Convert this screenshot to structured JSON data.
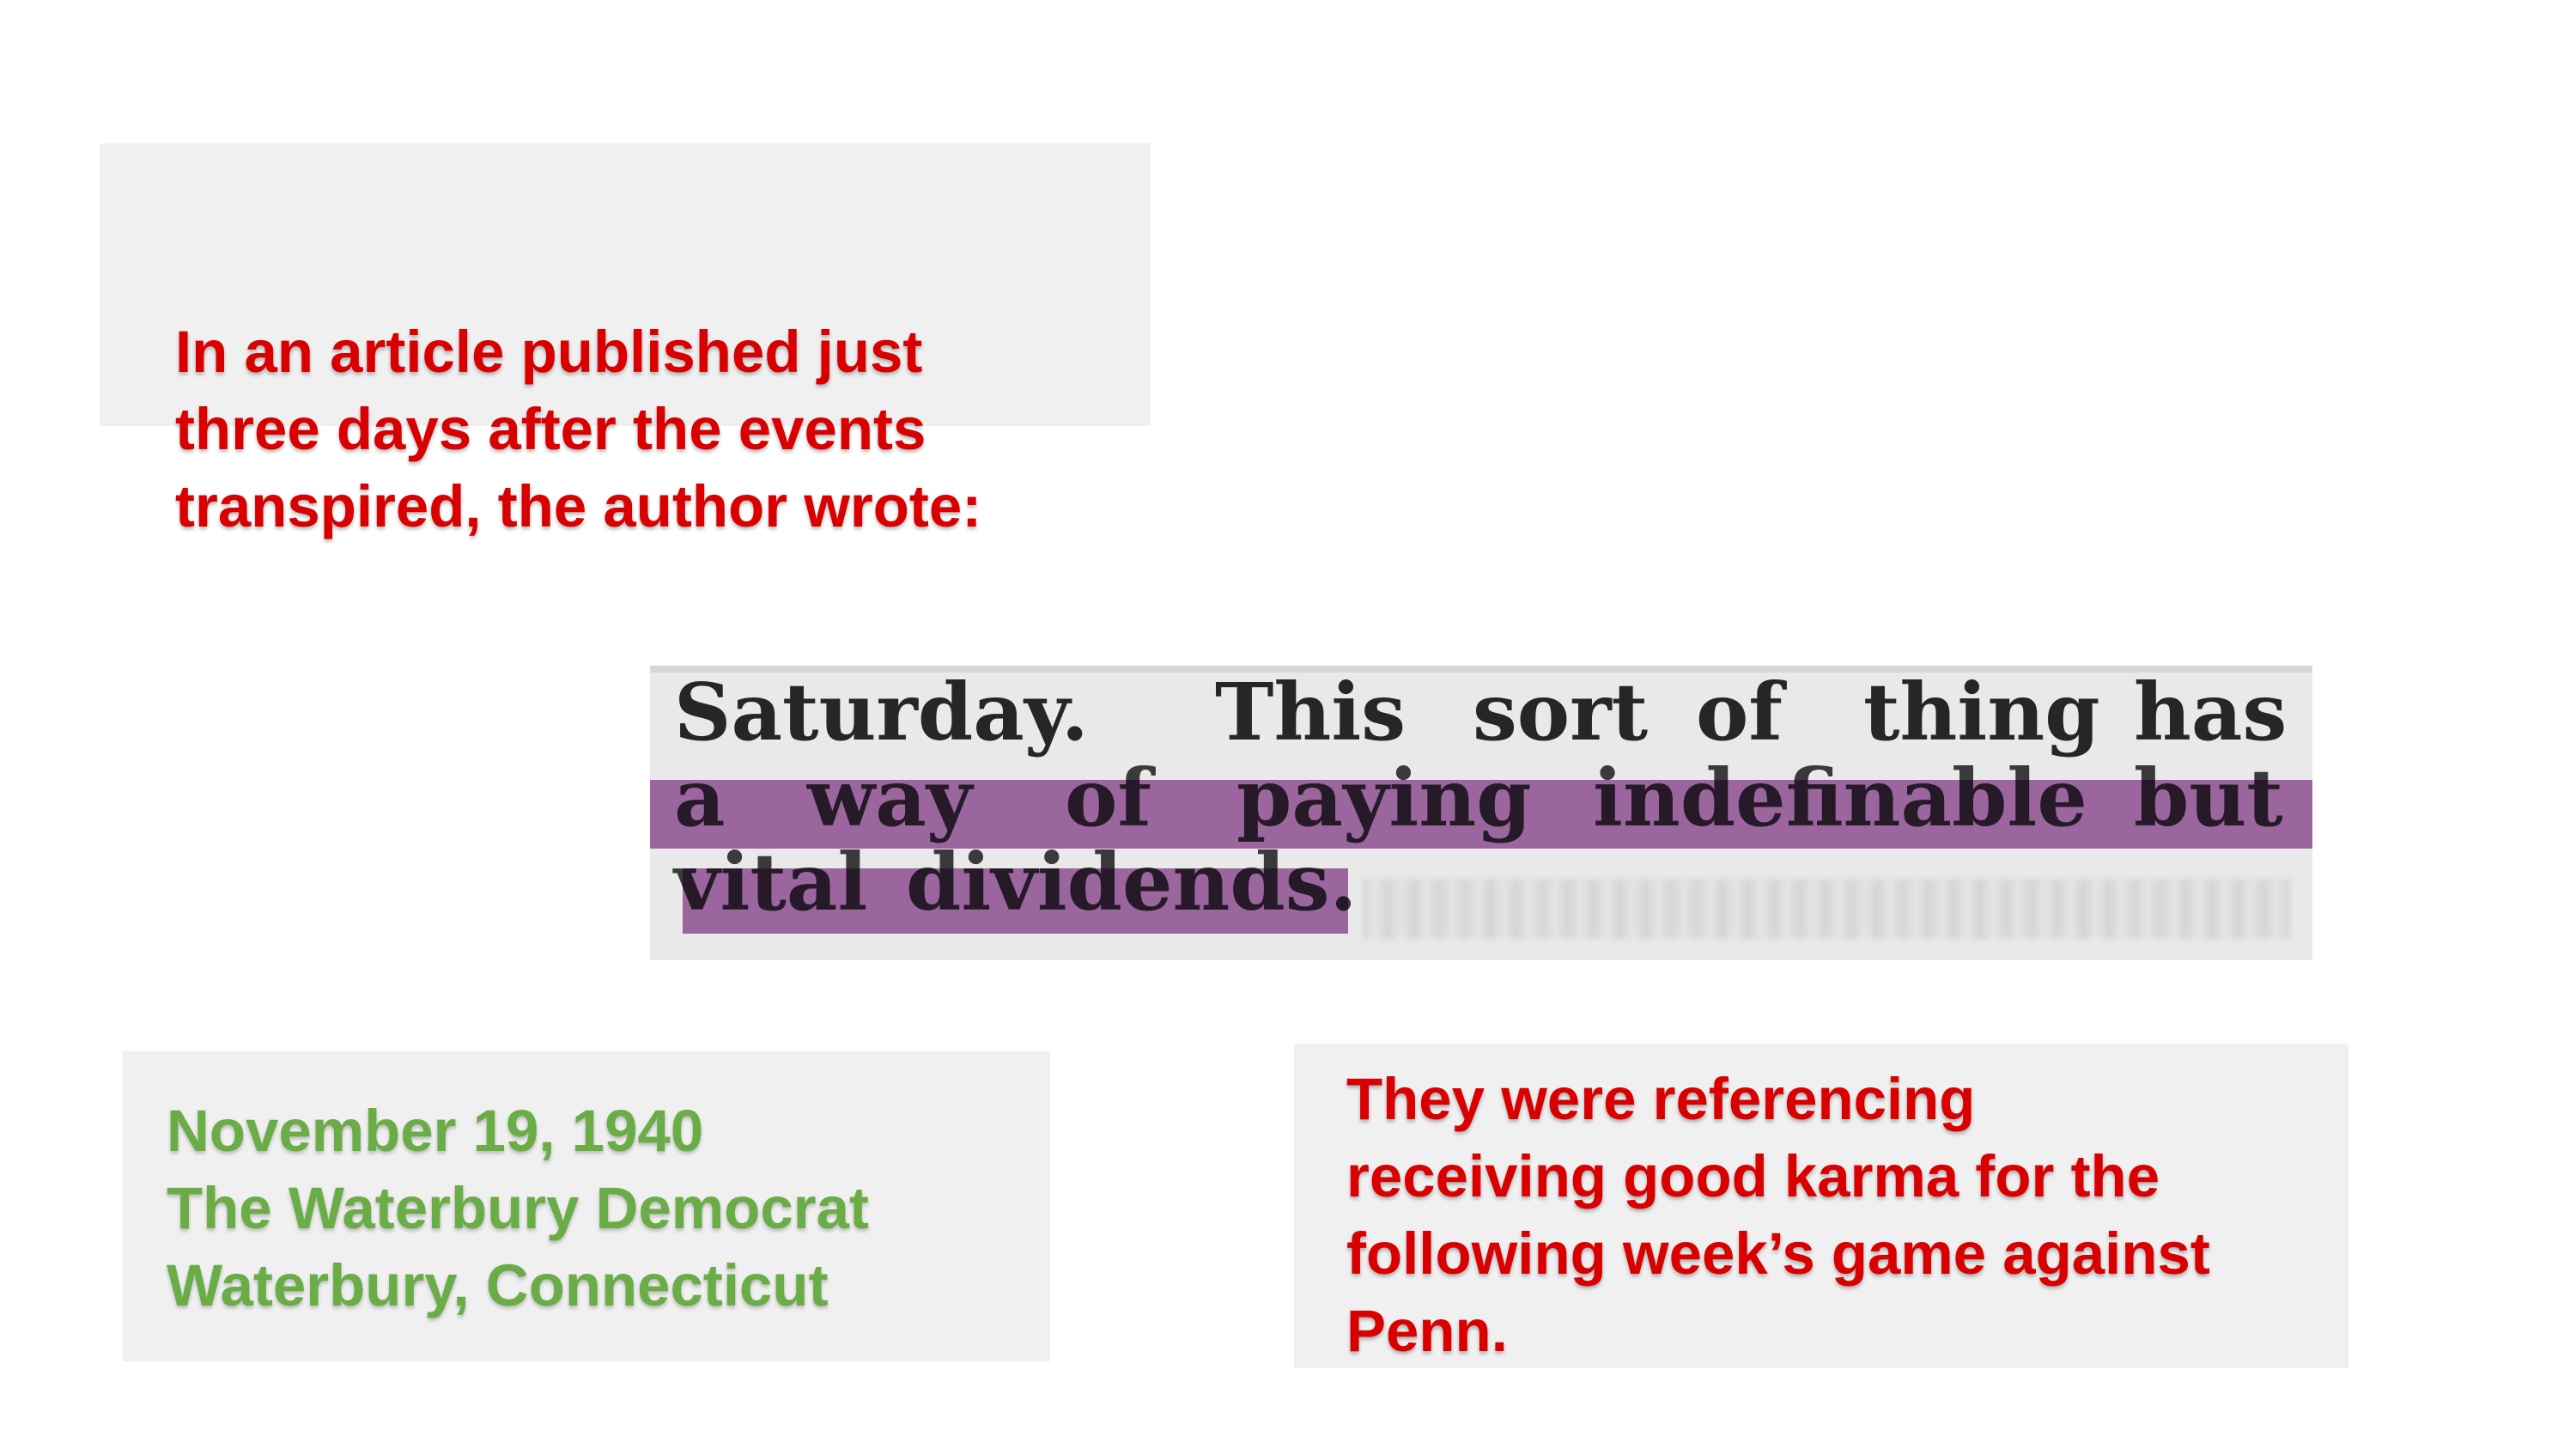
{
  "intro": {
    "lines": [
      "In an article published just",
      "three days after the events",
      "transpired, the author wrote:"
    ]
  },
  "clipping": {
    "line_1": [
      "Saturday.",
      "This",
      "sort",
      "of",
      "thing",
      "has"
    ],
    "line_2": [
      "a",
      "way",
      "of",
      "paying",
      "indefinable",
      "but"
    ],
    "line_3": [
      "vital",
      "dividends."
    ],
    "highlight_color": "#924896"
  },
  "source": {
    "lines": [
      "November 19, 1940",
      "The Waterbury Democrat",
      "Waterbury, Connecticut"
    ],
    "color": "#6aad47"
  },
  "note": {
    "lines": [
      "They were referencing",
      "receiving good karma for the",
      "following week’s game against",
      "Penn."
    ],
    "color": "#d80000"
  }
}
